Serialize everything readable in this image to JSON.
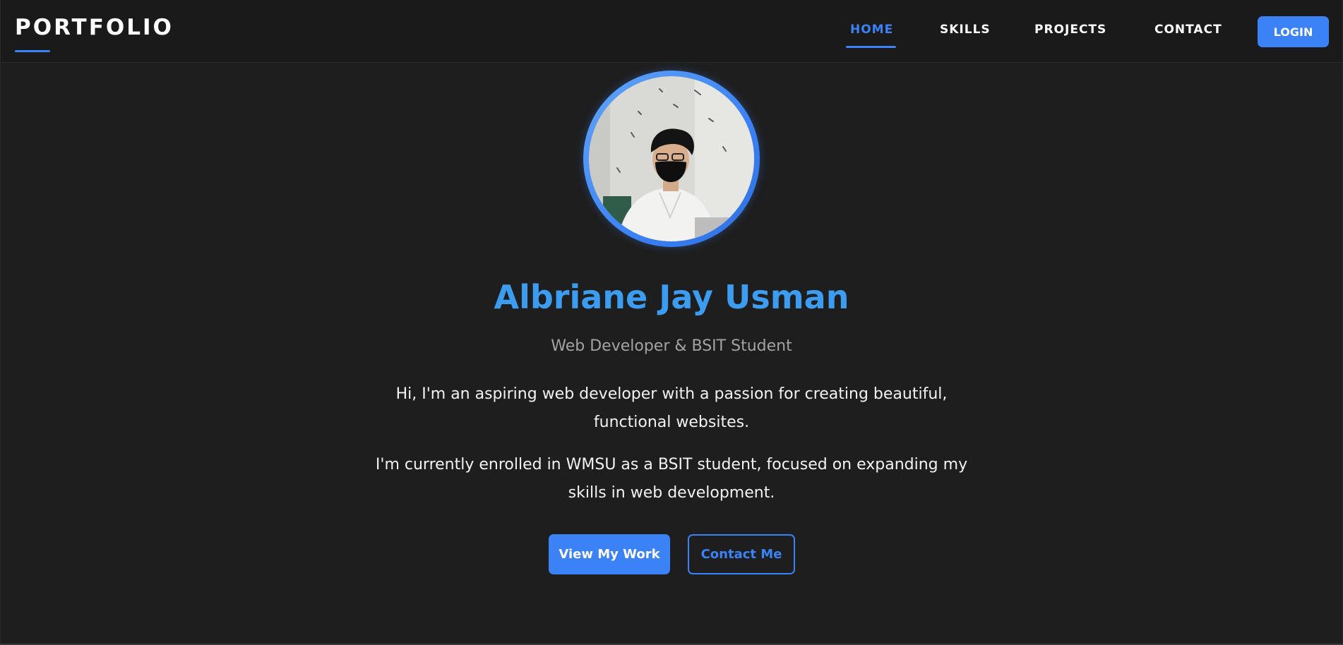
{
  "navbar": {
    "logo": "PORTFOLIO",
    "links": [
      {
        "label": "HOME",
        "active": true
      },
      {
        "label": "SKILLS",
        "active": false
      },
      {
        "label": "PROJECTS",
        "active": false
      },
      {
        "label": "CONTACT",
        "active": false
      }
    ],
    "login_label": "LOGIN"
  },
  "hero": {
    "avatar_alt": "profile-photo",
    "name": "Albriane Jay Usman",
    "subtitle": "Web Developer & BSIT Student",
    "paragraphs": [
      "Hi, I'm an aspiring web developer with a passion for creating beautiful, functional websites.",
      "I'm currently enrolled in WMSU as a BSIT student, focused on expanding my skills in web development."
    ],
    "primary_button": "View My Work",
    "secondary_button": "Contact Me"
  },
  "colors": {
    "accent": "#3b82f6",
    "name_color": "#3b9cf0",
    "background": "#1e1e1e",
    "navbar_background": "#1a1a1a",
    "subtitle_color": "#a3a3a3"
  }
}
